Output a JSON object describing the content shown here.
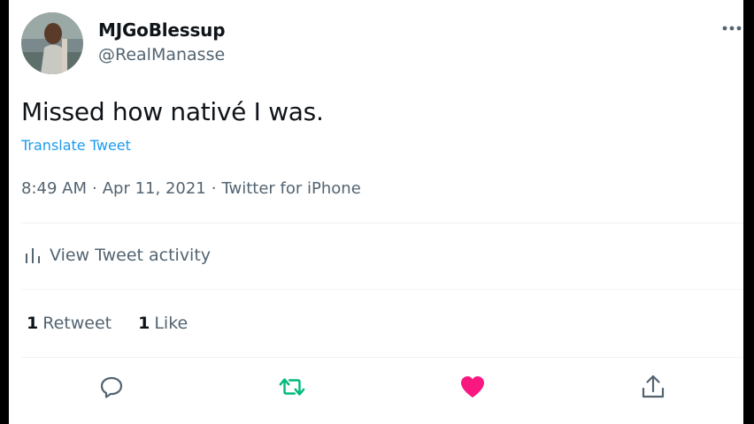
{
  "tweet": {
    "display_name": "MJGoBlessup",
    "handle": "@RealManasse",
    "text": "Missed how nativé I was.",
    "translate_label": "Translate Tweet",
    "time": "8:49 AM",
    "date": "Apr 11, 2021",
    "source": "Twitter for iPhone",
    "separator": "·"
  },
  "activity": {
    "label": "View Tweet activity",
    "icon": "analytics-bars-icon"
  },
  "stats": {
    "retweets": {
      "count": "1",
      "label": "Retweet"
    },
    "likes": {
      "count": "1",
      "label": "Like"
    }
  },
  "actions": {
    "reply_icon": "speech-bubble-icon",
    "retweet_icon": "retweet-arrows-icon",
    "like_icon": "heart-icon",
    "share_icon": "share-upload-icon"
  },
  "colors": {
    "accent_link": "#1d9bf0",
    "retweet_active": "#00ba7c",
    "like_active": "#f91880",
    "secondary_text": "#536471",
    "primary_text": "#0f1419"
  }
}
